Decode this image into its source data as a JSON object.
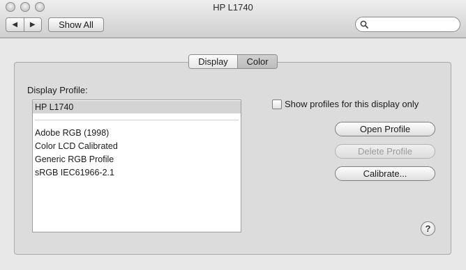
{
  "window": {
    "title": "HP L1740"
  },
  "toolbar": {
    "back_icon": "back-arrow-icon",
    "forward_icon": "forward-arrow-icon",
    "back_glyph": "◀",
    "forward_glyph": "▶",
    "show_all_label": "Show All",
    "search_placeholder": "",
    "search_value": ""
  },
  "tabs": [
    {
      "label": "Display",
      "selected": false
    },
    {
      "label": "Color",
      "selected": true
    }
  ],
  "display_profile": {
    "label": "Display Profile:",
    "selected_profile": "HP L1740",
    "profiles": [
      "Adobe RGB (1998)",
      "Color LCD Calibrated",
      "Generic RGB Profile",
      "sRGB IEC61966-2.1"
    ]
  },
  "options": {
    "show_profiles_label": "Show profiles for this display only",
    "show_profiles_checked": false
  },
  "buttons": {
    "open_profile": "Open Profile",
    "delete_profile": "Delete Profile",
    "calibrate": "Calibrate...",
    "help": "?"
  },
  "colors": {
    "selected_row": "#d4d4d4",
    "panel_background": "#dcdcdc"
  }
}
